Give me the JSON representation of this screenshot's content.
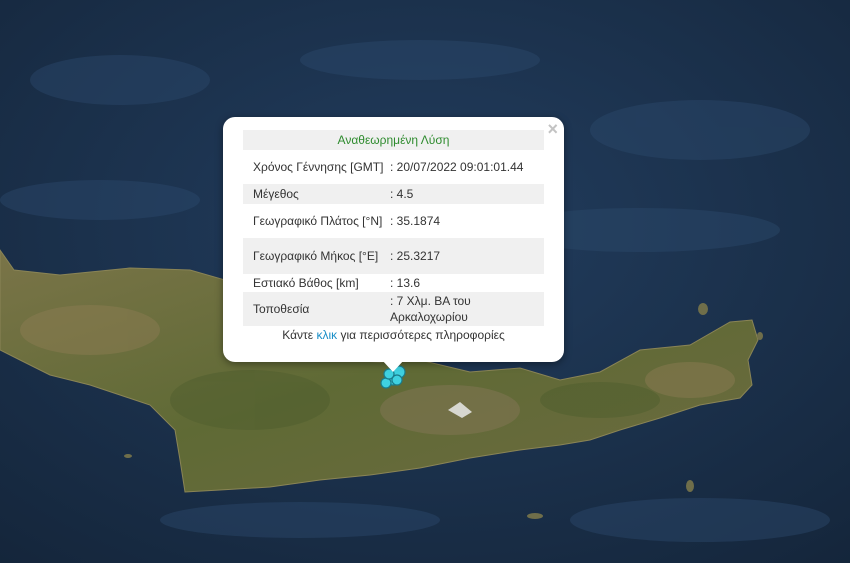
{
  "map": {
    "ocean_color": "#1d3450",
    "land_color": "#6e6a3c",
    "marker_color": "#3fd1e0"
  },
  "popup": {
    "close_label": "×",
    "header": "Αναθεωρημένη Λύση",
    "rows": [
      {
        "label": "Χρόνος Γέννησης [GMT]",
        "value": ": 20/07/2022 09:01:01.44"
      },
      {
        "label": "Μέγεθος",
        "value": ": 4.5"
      },
      {
        "label": "Γεωγραφικό Πλάτος [°N]",
        "value": ": 35.1874"
      },
      {
        "label": "Γεωγραφικό Μήκος [°E]",
        "value": ": 25.3217"
      },
      {
        "label": "Εστιακό Βάθος [km]",
        "value": ": 13.6"
      },
      {
        "label": "Τοποθεσία",
        "value": ": 7 Χλμ. ΒΑ του Αρκαλοχωρίου"
      }
    ],
    "more_prefix": "Κάντε ",
    "more_link": "κλικ",
    "more_suffix": " για περισσότερες πληροφορίες"
  }
}
